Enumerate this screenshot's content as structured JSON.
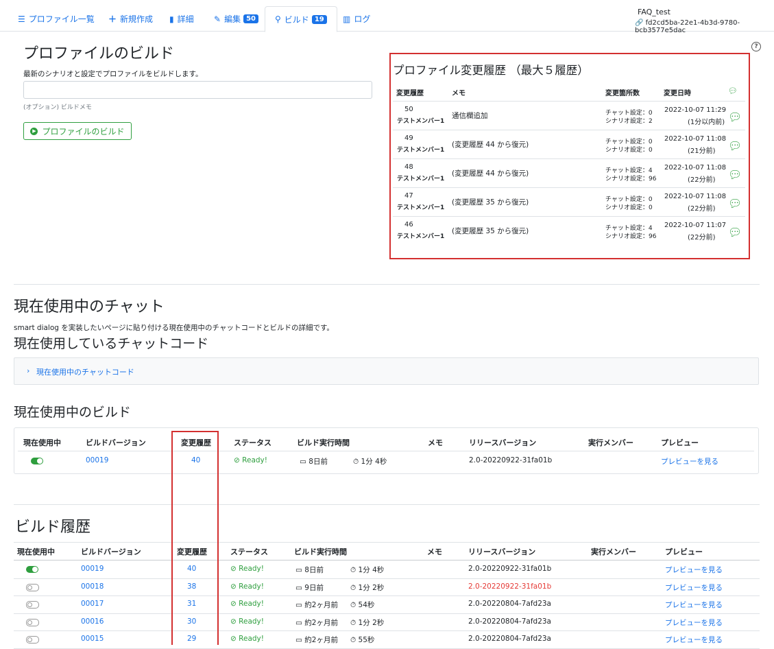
{
  "nav": {
    "tabs": [
      {
        "label": "プロファイル一覧",
        "icon": "list-icon"
      },
      {
        "label": "新規作成",
        "icon": "plus-icon"
      },
      {
        "label": "詳細",
        "icon": "file-icon"
      },
      {
        "label": "編集",
        "icon": "edit-icon",
        "badge": "50"
      },
      {
        "label": "ビルド",
        "icon": "build-icon",
        "badge": "19"
      },
      {
        "label": "ログ",
        "icon": "chart-icon"
      }
    ],
    "profile_name": "FAQ_test",
    "profile_id": "fd2cd5ba-22e1-4b3d-9780-bcb3577e5dac"
  },
  "build_section": {
    "title": "プロファイルのビルド",
    "description": "最新のシナリオと設定でプロファイルをビルドします。",
    "memo_placeholder": "",
    "memo_help": "(オプション) ビルドメモ",
    "button_label": "プロファイルのビルド"
  },
  "history": {
    "title": "プロファイル変更履歴 （最大５履歴）",
    "headers": [
      "変更履歴",
      "メモ",
      "変更箇所数",
      "変更日時"
    ],
    "rows": [
      {
        "num": "50",
        "member": "テストメンバー1",
        "memo": "通信欄追加",
        "chat": "チャット設定：0",
        "scenario": "シナリオ設定：2",
        "date": "2022-10-07 11:29",
        "ago": "(1分以内前)"
      },
      {
        "num": "49",
        "member": "テストメンバー1",
        "memo": "(変更履歴 44 から復元)",
        "chat": "チャット設定：0",
        "scenario": "シナリオ設定：0",
        "date": "2022-10-07 11:08",
        "ago": "(21分前)"
      },
      {
        "num": "48",
        "member": "テストメンバー1",
        "memo": "(変更履歴 44 から復元)",
        "chat": "チャット設定：4",
        "scenario": "シナリオ設定：96",
        "date": "2022-10-07 11:08",
        "ago": "(22分前)"
      },
      {
        "num": "47",
        "member": "テストメンバー1",
        "memo": "(変更履歴 35 から復元)",
        "chat": "チャット設定：0",
        "scenario": "シナリオ設定：0",
        "date": "2022-10-07 11:08",
        "ago": "(22分前)"
      },
      {
        "num": "46",
        "member": "テストメンバー1",
        "memo": "(変更履歴 35 から復元)",
        "chat": "チャット設定：4",
        "scenario": "シナリオ設定：96",
        "date": "2022-10-07 11:07",
        "ago": "(22分前)"
      }
    ]
  },
  "current_chat": {
    "title": "現在使用中のチャット",
    "description": "smart dialog を実装したいページに貼り付ける現在使用中のチャットコードとビルドの詳細です。",
    "code_title": "現在使用しているチャットコード",
    "code_toggle": "現在使用中のチャットコード"
  },
  "current_build": {
    "title": "現在使用中のビルド",
    "headers": [
      "現在使用中",
      "ビルドバージョン",
      "変更履歴",
      "ステータス",
      "ビルド実行時間",
      "メモ",
      "リリースバージョン",
      "実行メンバー",
      "プレビュー"
    ],
    "row": {
      "version": "00019",
      "history": "40",
      "status": "Ready!",
      "date": "8日前",
      "duration": "1分 4秒",
      "release": "2.0-20220922-31fa01b",
      "preview": "プレビューを見る",
      "active": true
    }
  },
  "build_history": {
    "title": "ビルド履歴",
    "headers": [
      "現在使用中",
      "ビルドバージョン",
      "変更履歴",
      "ステータス",
      "ビルド実行時間",
      "メモ",
      "リリースバージョン",
      "実行メンバー",
      "プレビュー"
    ],
    "rows": [
      {
        "version": "00019",
        "history": "40",
        "status": "Ready!",
        "date": "8日前",
        "duration": "1分 4秒",
        "release": "2.0-20220922-31fa01b",
        "release_color": "#212529",
        "preview": "プレビューを見る",
        "active": true
      },
      {
        "version": "00018",
        "history": "38",
        "status": "Ready!",
        "date": "9日前",
        "duration": "1分 2秒",
        "release": "2.0-20220922-31fa01b",
        "release_color": "#e53935",
        "preview": "プレビューを見る",
        "active": false
      },
      {
        "version": "00017",
        "history": "31",
        "status": "Ready!",
        "date": "約2ヶ月前",
        "duration": "54秒",
        "release": "2.0-20220804-7afd23a",
        "release_color": "#212529",
        "preview": "プレビューを見る",
        "active": false
      },
      {
        "version": "00016",
        "history": "30",
        "status": "Ready!",
        "date": "約2ヶ月前",
        "duration": "1分 2秒",
        "release": "2.0-20220804-7afd23a",
        "release_color": "#212529",
        "preview": "プレビューを見る",
        "active": false
      },
      {
        "version": "00015",
        "history": "29",
        "status": "Ready!",
        "date": "約2ヶ月前",
        "duration": "55秒",
        "release": "2.0-20220804-7afd23a",
        "release_color": "#212529",
        "preview": "プレビューを見る",
        "active": false
      }
    ]
  },
  "colors": {
    "accent": "#1a73e8",
    "success": "#2e9e3e",
    "highlight": "#d32f2f"
  }
}
